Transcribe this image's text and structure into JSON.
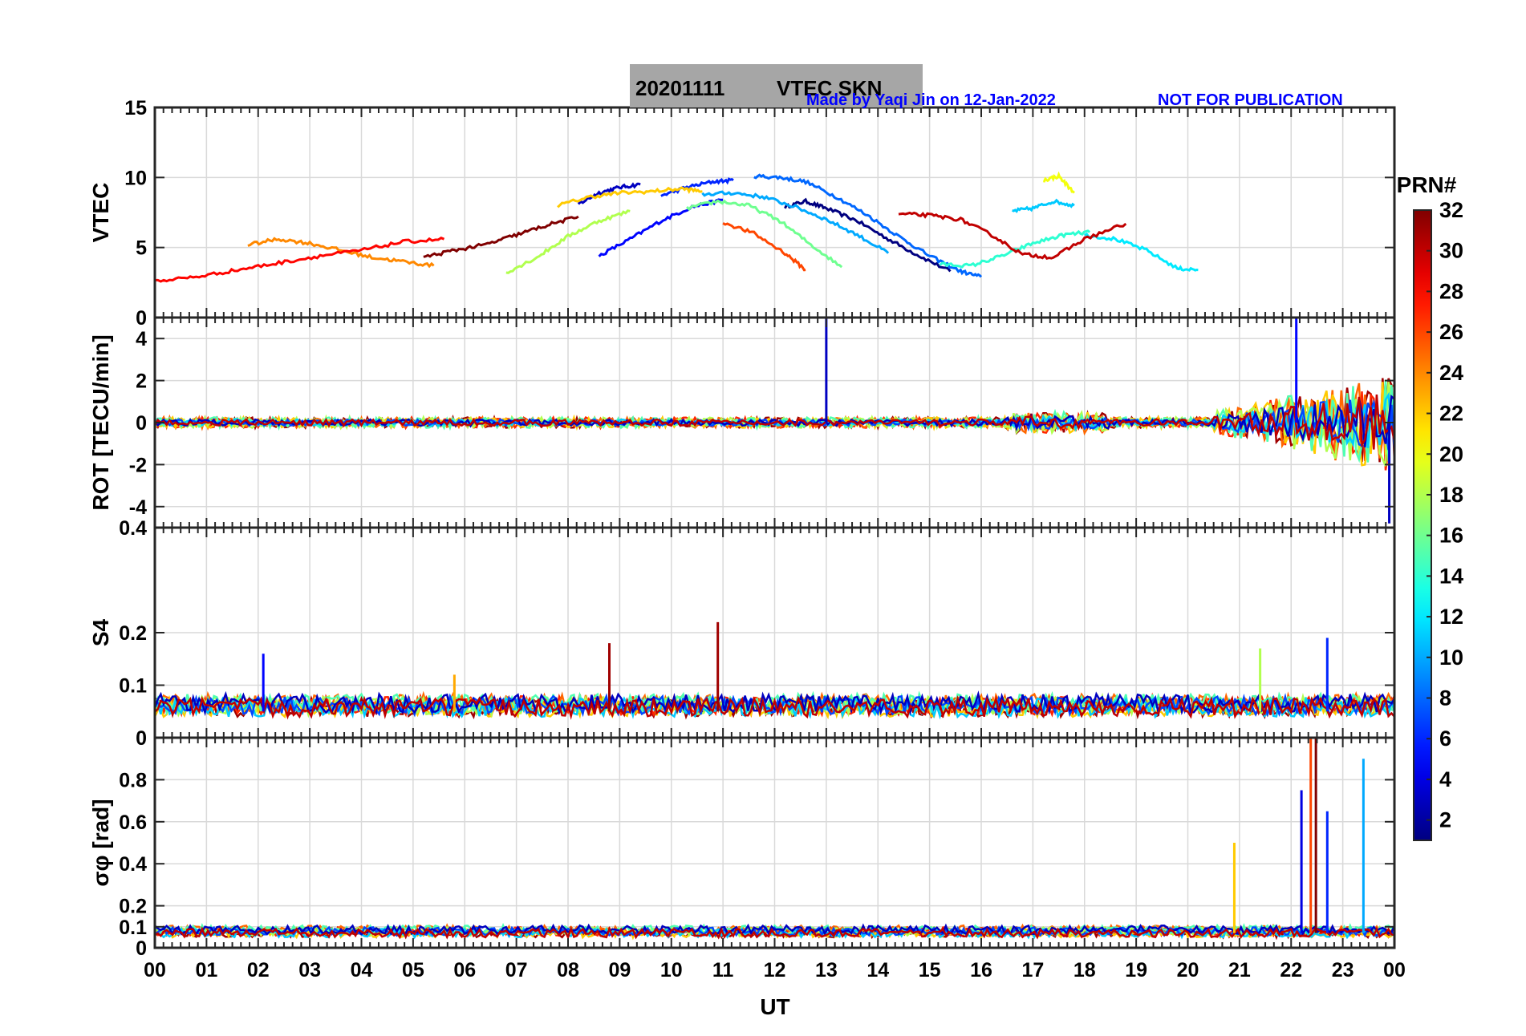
{
  "figure": {
    "title_date": "20201111",
    "title_text": "VTEC  SKN",
    "credit": "Made by Yaqi Jin on 12-Jan-2022",
    "notice": "NOT FOR PUBLICATION",
    "credit_color": "#0000ff",
    "title_box_color": "#a6a6a6"
  },
  "chart_data": {
    "type": "line",
    "x_axis": {
      "label": "UT",
      "range_hours": [
        0,
        24
      ],
      "ticks": [
        "00",
        "01",
        "02",
        "03",
        "04",
        "05",
        "06",
        "07",
        "08",
        "09",
        "10",
        "11",
        "12",
        "13",
        "14",
        "15",
        "16",
        "17",
        "18",
        "19",
        "20",
        "21",
        "22",
        "23",
        "00"
      ]
    },
    "grid": true,
    "colorbar": {
      "label": "PRN#",
      "range": [
        1,
        32
      ],
      "colormap": "jet",
      "ticks": [
        "2",
        "4",
        "6",
        "8",
        "10",
        "12",
        "14",
        "16",
        "18",
        "20",
        "22",
        "24",
        "26",
        "28",
        "30",
        "32"
      ],
      "placement": "right"
    },
    "panels": [
      {
        "ylabel": "VTEC",
        "ylim": [
          0,
          15
        ],
        "yticks": [
          "0",
          "5",
          "10",
          "15"
        ],
        "series": [
          {
            "prn": 1,
            "x": [
              12.2,
              12.6,
              13.0,
              13.6,
              14.2,
              14.8,
              15.4
            ],
            "y": [
              7.9,
              8.3,
              7.8,
              6.9,
              5.6,
              4.4,
              3.3
            ]
          },
          {
            "prn": 3,
            "x": [
              8.2,
              8.6,
              9.0,
              9.4
            ],
            "y": [
              8.1,
              8.9,
              9.3,
              9.5
            ]
          },
          {
            "prn": 5,
            "x": [
              8.6,
              9.2,
              9.8,
              10.4,
              11.0
            ],
            "y": [
              4.4,
              5.6,
              6.9,
              7.9,
              8.4
            ]
          },
          {
            "prn": 6,
            "x": [
              9.8,
              10.3,
              10.8,
              11.2
            ],
            "y": [
              8.7,
              9.3,
              9.7,
              9.8
            ]
          },
          {
            "prn": 8,
            "x": [
              11.6,
              12.1,
              12.6,
              13.2,
              13.8,
              14.4,
              15.0,
              15.6,
              16.0
            ],
            "y": [
              10.1,
              10.0,
              9.7,
              8.6,
              7.3,
              5.8,
              4.4,
              3.3,
              2.9
            ]
          },
          {
            "prn": 10,
            "x": [
              10.6,
              11.2,
              11.8,
              12.4,
              13.0,
              13.6,
              14.2
            ],
            "y": [
              8.8,
              8.9,
              8.6,
              7.9,
              7.0,
              5.9,
              4.6
            ]
          },
          {
            "prn": 11,
            "x": [
              16.6,
              17.0,
              17.4,
              17.8
            ],
            "y": [
              7.6,
              7.8,
              8.3,
              8.0
            ]
          },
          {
            "prn": 12,
            "x": [
              18.0,
              18.6,
              19.2,
              19.8,
              20.2
            ],
            "y": [
              5.9,
              5.6,
              4.8,
              3.5,
              3.4
            ]
          },
          {
            "prn": 14,
            "x": [
              15.2,
              15.8,
              16.4,
              17.0,
              17.6,
              18.1
            ],
            "y": [
              3.8,
              3.7,
              4.4,
              5.3,
              5.9,
              6.1
            ]
          },
          {
            "prn": 16,
            "x": [
              10.3,
              10.9,
              11.5,
              12.1,
              12.7,
              13.3
            ],
            "y": [
              7.8,
              8.3,
              8.0,
              6.9,
              5.2,
              3.6
            ]
          },
          {
            "prn": 18,
            "x": [
              6.8,
              7.4,
              8.0,
              8.6,
              9.2
            ],
            "y": [
              3.2,
              4.3,
              5.8,
              6.9,
              7.6
            ]
          },
          {
            "prn": 20,
            "x": [
              17.2,
              17.5,
              17.8
            ],
            "y": [
              9.8,
              10.1,
              8.9
            ]
          },
          {
            "prn": 22,
            "x": [
              7.8,
              8.4,
              9.0,
              9.6,
              10.2,
              10.6
            ],
            "y": [
              8.0,
              8.6,
              8.9,
              9.0,
              9.2,
              9.0
            ]
          },
          {
            "prn": 24,
            "x": [
              1.8,
              2.4,
              3.0,
              3.6,
              4.2,
              4.8,
              5.4
            ],
            "y": [
              5.2,
              5.6,
              5.3,
              4.8,
              4.3,
              4.0,
              3.7
            ]
          },
          {
            "prn": 26,
            "x": [
              11.0,
              11.6,
              12.2,
              12.6
            ],
            "y": [
              6.8,
              6.0,
              4.6,
              3.4
            ]
          },
          {
            "prn": 28,
            "x": [
              0.0,
              0.8,
              1.6,
              2.4,
              3.2,
              4.0,
              4.8,
              5.6
            ],
            "y": [
              2.6,
              2.9,
              3.4,
              3.9,
              4.4,
              4.8,
              5.4,
              5.6
            ]
          },
          {
            "prn": 30,
            "x": [
              14.4,
              15.0,
              15.6,
              16.2,
              16.8,
              17.4,
              18.0,
              18.8
            ],
            "y": [
              7.4,
              7.3,
              7.0,
              5.9,
              4.5,
              4.3,
              5.6,
              6.7
            ]
          },
          {
            "prn": 32,
            "x": [
              5.2,
              5.8,
              6.4,
              7.0,
              7.6,
              8.2
            ],
            "y": [
              4.3,
              4.8,
              5.2,
              5.9,
              6.6,
              7.2
            ]
          }
        ]
      },
      {
        "ylabel": "ROT [TECU/min]",
        "ylim": [
          -5,
          5
        ],
        "yticks": [
          "-4",
          "-2",
          "0",
          "2",
          "4"
        ],
        "notes": "near-zero fluctuations before 20 UT; strong fluctuations between 20.5 and 24 UT",
        "spikes": [
          {
            "prn": 3,
            "x": 13.0,
            "y": 5.2
          },
          {
            "prn": 5,
            "x": 22.1,
            "y": 5.4
          },
          {
            "prn": 3,
            "x": 23.9,
            "y": -4.8
          }
        ]
      },
      {
        "ylabel": "S4",
        "ylim": [
          0,
          0.4
        ],
        "yticks": [
          "0",
          "0.1",
          "0.2",
          "0.4"
        ],
        "notes": "background level about 0.03-0.08",
        "spikes": [
          {
            "prn": 5,
            "x": 2.1,
            "y": 0.16
          },
          {
            "prn": 23,
            "x": 5.8,
            "y": 0.12
          },
          {
            "prn": 31,
            "x": 8.8,
            "y": 0.18
          },
          {
            "prn": 31,
            "x": 10.9,
            "y": 0.22
          },
          {
            "prn": 18,
            "x": 21.4,
            "y": 0.17
          },
          {
            "prn": 6,
            "x": 22.7,
            "y": 0.19
          }
        ]
      },
      {
        "ylabel": "σφ [rad]",
        "ylim": [
          0,
          1
        ],
        "yticks": [
          "0",
          "0.1",
          "0.2",
          "0.4",
          "0.6",
          "0.8"
        ],
        "notes": "background level about 0.05-0.1",
        "spikes": [
          {
            "prn": 22,
            "x": 20.9,
            "y": 0.5
          },
          {
            "prn": 4,
            "x": 22.2,
            "y": 0.75
          },
          {
            "prn": 26,
            "x": 22.38,
            "y": 1.0
          },
          {
            "prn": 32,
            "x": 22.48,
            "y": 1.0
          },
          {
            "prn": 6,
            "x": 22.7,
            "y": 0.65
          },
          {
            "prn": 10,
            "x": 23.4,
            "y": 0.9
          }
        ]
      }
    ]
  }
}
